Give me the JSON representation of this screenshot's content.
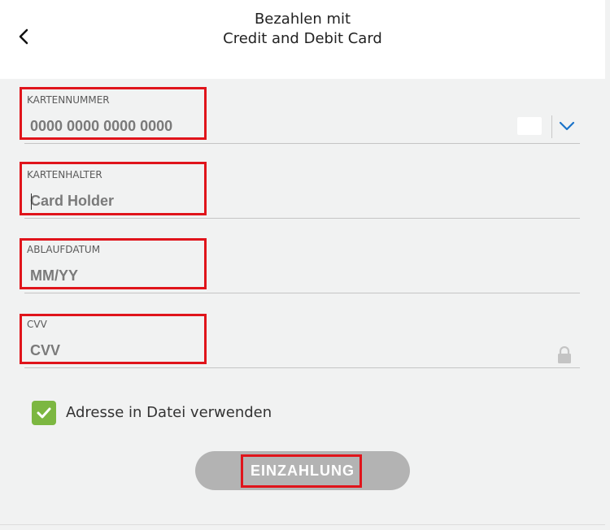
{
  "header": {
    "title_line1": "Bezahlen mit",
    "title_line2": "Credit and Debit Card",
    "back_icon": "chevron-left-icon"
  },
  "form": {
    "card_number": {
      "label": "KARTENNUMMER",
      "placeholder": "0000 0000 0000 0000",
      "dropdown_icon": "chevron-down-icon"
    },
    "card_holder": {
      "label": "KARTENHALTER",
      "placeholder": "Card Holder"
    },
    "expiry": {
      "label": "ABLAUFDATUM",
      "placeholder": "MM/YY"
    },
    "cvv": {
      "label": "CVV",
      "placeholder": "CVV",
      "icon": "lock-icon"
    }
  },
  "address_checkbox": {
    "label": "Adresse in Datei verwenden",
    "checked": true
  },
  "submit": {
    "label": "EINZAHLUNG"
  },
  "colors": {
    "highlight": "#e0141b",
    "checkbox": "#7cb741",
    "accent": "#1a73c9",
    "button_disabled": "#b3b3b3"
  }
}
